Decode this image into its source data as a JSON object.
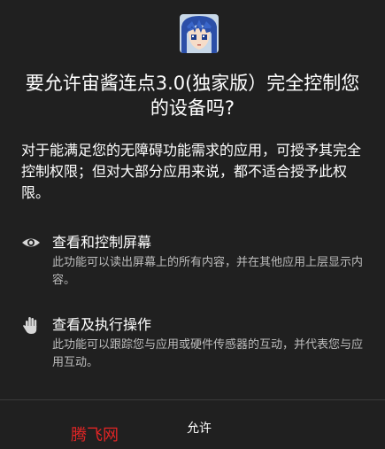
{
  "dialog": {
    "app_icon": "anime-avatar-icon",
    "title": "要允许宙酱连点3.0(独家版）完全控制您的设备吗?",
    "description": "对于能满足您的无障碍功能需求的应用，可授予其完全控制权限；但对大部分应用来说，都不适合授予此权限。",
    "permissions": [
      {
        "icon": "eye-icon",
        "title": "查看和控制屏幕",
        "description": "此功能可以读出屏幕上的所有内容，并在其他应用上层显示内容。"
      },
      {
        "icon": "hand-icon",
        "title": "查看及执行操作",
        "description": "此功能可以跟踪您与应用或硬件传感器的互动，并代表您与应用互动。"
      }
    ],
    "allow_button": "允许"
  },
  "watermark": "腾飞网",
  "colors": {
    "background": "#202020",
    "text_primary": "#ffffff",
    "text_secondary": "#bdbdbd",
    "watermark": "#e02525"
  }
}
